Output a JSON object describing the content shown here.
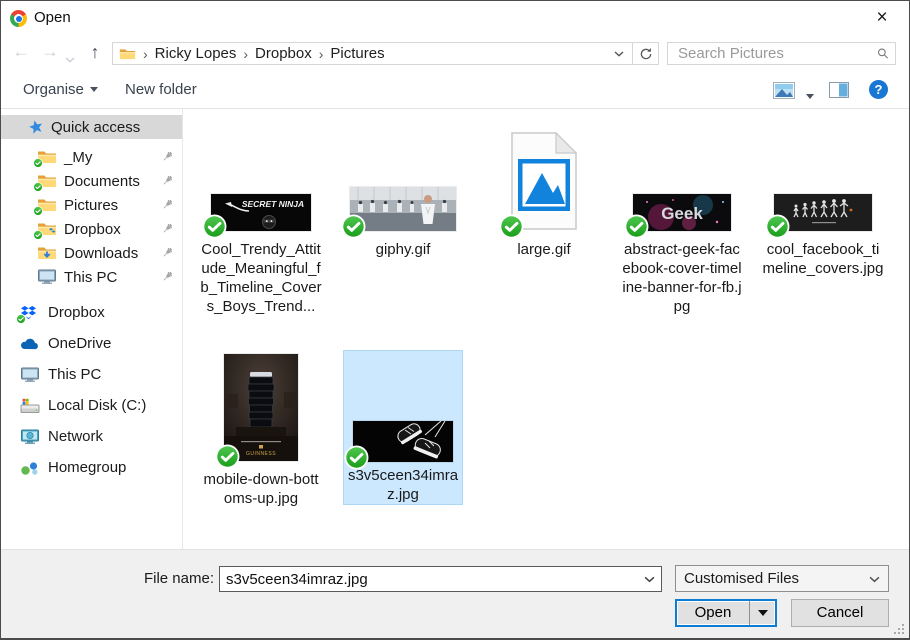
{
  "window": {
    "title": "Open"
  },
  "titlebar": {
    "close_glyph": "×"
  },
  "icons": {
    "back_glyph": "←",
    "forward_glyph": "→",
    "up_glyph": "↑",
    "help_glyph": "?",
    "crumb_sep": "›"
  },
  "navbar": {
    "crumbs": [
      "Ricky Lopes",
      "Dropbox",
      "Pictures"
    ],
    "search_placeholder": "Search Pictures"
  },
  "toolbar": {
    "organise": "Organise",
    "new_folder": "New folder"
  },
  "sidebar": {
    "quick_access_label": "Quick access",
    "quick_items": [
      {
        "label": "_My",
        "icon": "folder-synced-icon",
        "pinned": true
      },
      {
        "label": "Documents",
        "icon": "folder-synced-icon",
        "pinned": true
      },
      {
        "label": "Pictures",
        "icon": "folder-synced-icon",
        "pinned": true
      },
      {
        "label": "Dropbox",
        "icon": "dropbox-folder-synced-icon",
        "pinned": true
      },
      {
        "label": "Downloads",
        "icon": "downloads-folder-icon",
        "pinned": true
      },
      {
        "label": "This PC",
        "icon": "computer-icon",
        "pinned": true
      }
    ],
    "places": [
      {
        "label": "Dropbox",
        "icon": "dropbox-logo-synced-icon"
      },
      {
        "label": "OneDrive",
        "icon": "onedrive-cloud-icon"
      },
      {
        "label": "This PC",
        "icon": "computer-icon"
      },
      {
        "label": "Local Disk (C:)",
        "icon": "local-disk-icon"
      },
      {
        "label": "Network",
        "icon": "network-icon"
      },
      {
        "label": "Homegroup",
        "icon": "homegroup-icon"
      }
    ]
  },
  "files": [
    {
      "caption": "Cool_Trendy_Attitude_Meaningful_fb_Timeline_Covers_Boys_Trend...",
      "thumb_text": "SECRET NINJA",
      "synced": true,
      "selected": false
    },
    {
      "caption": "giphy.gif",
      "synced": true,
      "selected": false
    },
    {
      "caption": "large.gif",
      "synced": true,
      "selected": false
    },
    {
      "caption": "abstract-geek-facebook-cover-timeline-banner-for-fb.jpg",
      "thumb_text": "Geek",
      "synced": true,
      "selected": false
    },
    {
      "caption": "cool_facebook_timeline_covers.jpg",
      "synced": true,
      "selected": false
    },
    {
      "caption": "mobile-down-bottoms-up.jpg",
      "thumb_text": "GUINNESS",
      "synced": true,
      "selected": false
    },
    {
      "caption": "s3v5ceen34imraz.jpg",
      "synced": true,
      "selected": true
    }
  ],
  "footer": {
    "file_name_label": "File name:",
    "file_name_value": "s3v5ceen34imraz.jpg",
    "file_type_value": "Customised Files",
    "open_label": "Open",
    "cancel_label": "Cancel"
  },
  "colors": {
    "selection_fill": "#cce8ff",
    "sync_badge_green": "#2eb02c",
    "default_button_border": "#0c7cd5",
    "help_blue": "#1877d2",
    "dropbox_blue": "#0062ff"
  }
}
